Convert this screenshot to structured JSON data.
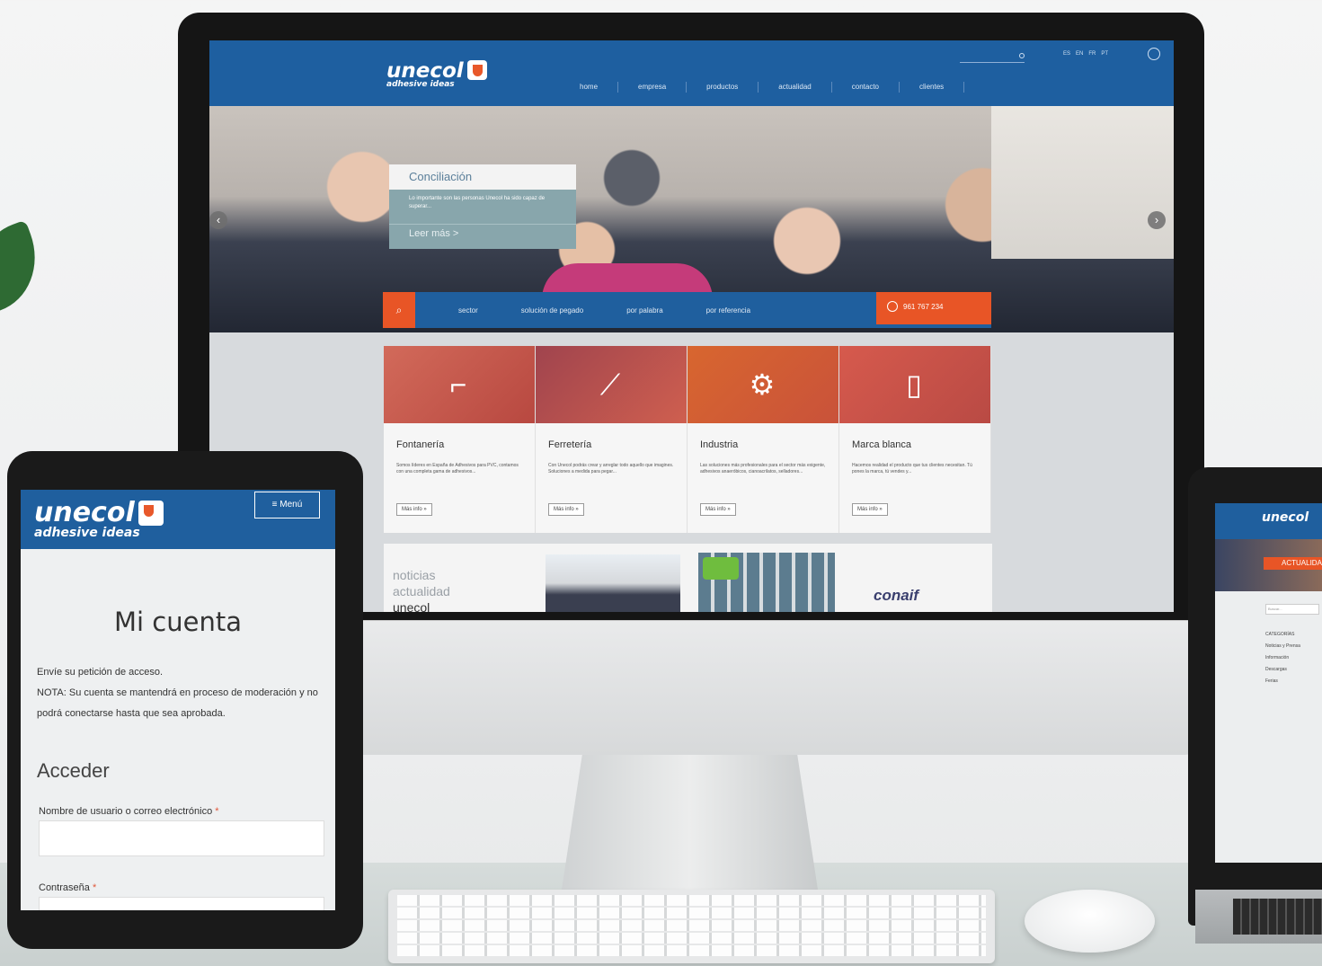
{
  "desktop": {
    "logo": {
      "name": "unecol",
      "tagline": "adhesive ideas"
    },
    "nav": [
      "home",
      "empresa",
      "productos",
      "actualidad",
      "contacto",
      "clientes"
    ],
    "languages": [
      "ES",
      "EN",
      "FR",
      "PT"
    ],
    "slider": {
      "title": "Conciliación",
      "text": "Lo importante son las personas Unecol ha sido capaz de superar...",
      "more": "Leer más >",
      "prev": "‹",
      "next": "›"
    },
    "search_options": [
      "sector",
      "solución de pegado",
      "por palabra",
      "por referencia"
    ],
    "phone": "961 767 234",
    "categories": [
      {
        "title": "Fontanería",
        "text": "Somos líderes en España de Adhesivos para PVC, contamos con una completa gama de adhesivos...",
        "button": "Más info »",
        "icon": "faucet-icon"
      },
      {
        "title": "Ferretería",
        "text": "Con Unecol podrás crear y arreglar todo aquello que imagines. Soluciones a medida para pegar...",
        "button": "Más info »",
        "icon": "pipette-icon"
      },
      {
        "title": "Industria",
        "text": "Las soluciones más profesionales para el sector más exigente, adhesivos anaeróbicos, cianoacrilatos, selladores...",
        "button": "Más info »",
        "icon": "gears-icon"
      },
      {
        "title": "Marca blanca",
        "text": "Hacemos realidad el producto que tus clientes necesitan. Tú pones la marca, tú vendes y...",
        "button": "Más info »",
        "icon": "glue-bottle-icon"
      }
    ],
    "news": {
      "label_line1": "noticias",
      "label_line2": "actualidad",
      "label_line3": "unecol",
      "partner": "conaif"
    }
  },
  "tablet": {
    "logo": {
      "name": "unecol",
      "tagline": "adhesive ideas"
    },
    "menu": "≡ Menú",
    "page_title": "Mi cuenta",
    "intro": "Envíe su petición de acceso.",
    "note": "NOTA: Su cuenta se mantendrá en proceso de moderación y no podrá conectarse hasta que sea aprobada.",
    "section_title": "Acceder",
    "username_label": "Nombre de usuario o correo electrónico",
    "password_label": "Contraseña",
    "required_mark": "*"
  },
  "laptop": {
    "logo": "unecol",
    "banner": "ACTUALIDAD",
    "search_placeholder": "Buscar...",
    "categories_title": "CATEGORÍAS",
    "categories": [
      "Noticias y Prensa",
      "Información",
      "Descargas",
      "Ferias"
    ]
  },
  "colors": {
    "brand_blue": "#1f5f9e",
    "accent_orange": "#e85526",
    "card_red": "#c9523a"
  }
}
